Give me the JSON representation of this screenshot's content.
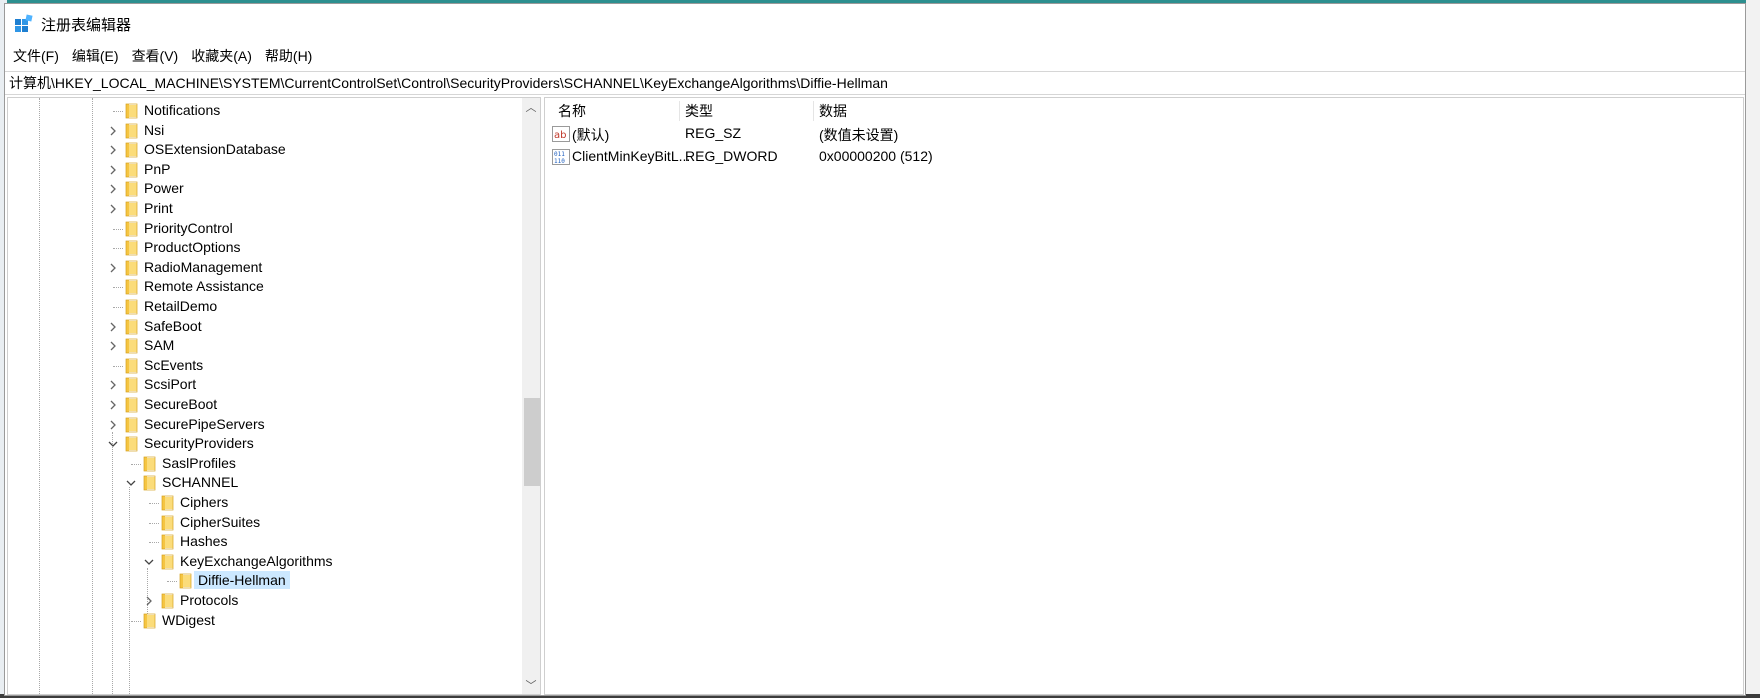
{
  "window": {
    "title": "注册表编辑器"
  },
  "menu": [
    "文件(F)",
    "编辑(E)",
    "查看(V)",
    "收藏夹(A)",
    "帮助(H)"
  ],
  "address": "计算机\\HKEY_LOCAL_MACHINE\\SYSTEM\\CurrentControlSet\\Control\\SecurityProviders\\SCHANNEL\\KeyExchangeAlgorithms\\Diffie-Hellman",
  "tree": [
    {
      "label": "Notifications",
      "expander": "none",
      "selected": false
    },
    {
      "label": "Nsi",
      "expander": "collapsed",
      "selected": false
    },
    {
      "label": "OSExtensionDatabase",
      "expander": "collapsed",
      "selected": false
    },
    {
      "label": "PnP",
      "expander": "collapsed",
      "selected": false
    },
    {
      "label": "Power",
      "expander": "collapsed",
      "selected": false
    },
    {
      "label": "Print",
      "expander": "collapsed",
      "selected": false
    },
    {
      "label": "PriorityControl",
      "expander": "none",
      "selected": false
    },
    {
      "label": "ProductOptions",
      "expander": "none",
      "selected": false
    },
    {
      "label": "RadioManagement",
      "expander": "collapsed",
      "selected": false
    },
    {
      "label": "Remote Assistance",
      "expander": "none",
      "selected": false
    },
    {
      "label": "RetailDemo",
      "expander": "none",
      "selected": false
    },
    {
      "label": "SafeBoot",
      "expander": "collapsed",
      "selected": false
    },
    {
      "label": "SAM",
      "expander": "collapsed",
      "selected": false
    },
    {
      "label": "ScEvents",
      "expander": "none",
      "selected": false
    },
    {
      "label": "ScsiPort",
      "expander": "collapsed",
      "selected": false
    },
    {
      "label": "SecureBoot",
      "expander": "collapsed",
      "selected": false
    },
    {
      "label": "SecurePipeServers",
      "expander": "collapsed",
      "selected": false
    },
    {
      "label": "SecurityProviders",
      "expander": "expanded",
      "selected": false
    },
    {
      "label": "SaslProfiles",
      "expander": "none",
      "selected": false
    },
    {
      "label": "SCHANNEL",
      "expander": "expanded",
      "selected": false
    },
    {
      "label": "Ciphers",
      "expander": "none",
      "selected": false
    },
    {
      "label": "CipherSuites",
      "expander": "none",
      "selected": false
    },
    {
      "label": "Hashes",
      "expander": "none",
      "selected": false
    },
    {
      "label": "KeyExchangeAlgorithms",
      "expander": "expanded",
      "selected": false
    },
    {
      "label": "Diffie-Hellman",
      "expander": "none",
      "selected": true
    },
    {
      "label": "Protocols",
      "expander": "collapsed",
      "selected": false
    },
    {
      "label": "WDigest",
      "expander": "none",
      "selected": false
    }
  ],
  "list": {
    "headers": {
      "name": "名称",
      "type": "类型",
      "data": "数据"
    },
    "rows": [
      {
        "icon": "string-value-icon",
        "name": "(默认)",
        "type": "REG_SZ",
        "data": "(数值未设置)"
      },
      {
        "icon": "dword-value-icon",
        "name": "ClientMinKeyBitL...",
        "type": "REG_DWORD",
        "data": "0x00000200 (512)"
      }
    ]
  },
  "colors": {
    "selection": "#cce8ff",
    "folder": "#f5c542",
    "scroll_thumb": "#cdcdcd"
  }
}
